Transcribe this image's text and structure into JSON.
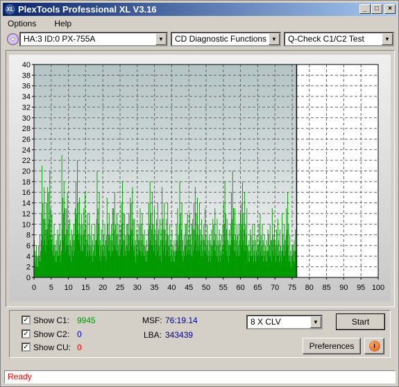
{
  "window": {
    "title": "PlexTools Professional XL V3.16",
    "logo": "XL"
  },
  "menu": [
    "Options",
    "Help"
  ],
  "toolbar": {
    "drive": "HA:3 ID:0  PX-755A",
    "function": "CD Diagnostic Functions",
    "test": "Q-Check C1/C2 Test"
  },
  "chart_data": {
    "type": "bar",
    "xlim": [
      0,
      100
    ],
    "ylim": [
      0,
      40
    ],
    "xticks": [
      0,
      5,
      10,
      15,
      20,
      25,
      30,
      35,
      40,
      45,
      50,
      55,
      60,
      65,
      70,
      75,
      80,
      85,
      90,
      95,
      100
    ],
    "yticks": [
      0,
      2,
      4,
      6,
      8,
      10,
      12,
      14,
      16,
      18,
      20,
      22,
      24,
      26,
      28,
      30,
      32,
      34,
      36,
      38,
      40
    ],
    "grid": true,
    "series": [
      {
        "color": "#009900",
        "x_end": 76.3,
        "values": [
          7,
          8,
          21,
          17,
          20,
          12,
          9,
          10,
          23,
          16,
          11,
          13,
          22,
          15,
          16,
          12,
          12,
          10,
          20,
          11,
          10,
          15,
          13,
          16,
          12,
          18,
          12,
          15,
          17,
          11,
          13,
          12,
          9,
          18,
          16,
          14,
          11,
          17,
          14,
          10,
          9,
          13,
          18,
          10,
          12,
          12,
          17,
          15,
          14,
          13,
          10,
          11,
          13,
          11,
          10,
          18,
          11,
          20,
          13,
          12,
          18,
          16,
          9,
          10,
          10,
          12,
          10,
          9,
          10,
          13,
          11,
          9,
          12,
          16,
          8,
          9,
          10
        ]
      }
    ]
  },
  "controls": {
    "show_c1": "Show C1:",
    "c1": "9945",
    "show_c2": "Show C2:",
    "c2": "0",
    "show_cu": "Show CU:",
    "cu": "0",
    "msf_label": "MSF:",
    "msf": "76:19.14",
    "lba_label": "LBA:",
    "lba": "343439",
    "speed": "8 X CLV",
    "start": "Start",
    "preferences": "Preferences"
  },
  "status": "Ready"
}
